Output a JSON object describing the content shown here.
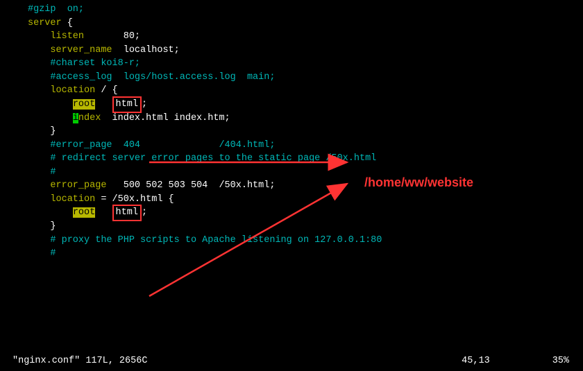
{
  "lines": {
    "l0": "#gzip  on;",
    "l1": "",
    "l2_a": "server {",
    "l3_a": "listen",
    "l3_b": "       80;",
    "l4_a": "server_name",
    "l4_b": "  localhost;",
    "l5": "",
    "l6": "#charset koi8-r;",
    "l7": "",
    "l8": "#access_log  logs/host.access.log  main;",
    "l9": "",
    "l10_a": "location",
    "l10_b": " / {",
    "l11_a": "root",
    "l11_b": "html",
    "l11_c": ";",
    "l12_a": "i",
    "l12_b": "ndex",
    "l12_c": "  index.html index.htm;",
    "l13": "}",
    "l14": "",
    "l15": "#error_page  404              /404.html;",
    "l16": "",
    "l17": "# redirect server error pages to the static page /50x.html",
    "l18": "#",
    "l19_a": "error_page",
    "l19_b": "   500 502 503 504  /50x.html;",
    "l20_a": "location",
    "l20_b": " = /50x.html {",
    "l21_a": "root",
    "l21_b": "html",
    "l21_c": ";",
    "l22": "}",
    "l23": "",
    "l24": "# proxy the PHP scripts to Apache listening on 127.0.0.1:80",
    "l25": "#"
  },
  "annotation": "/home/ww/website",
  "status": {
    "file": "\"nginx.conf\" 117L, 2656C",
    "position": "45,13",
    "percent": "35%"
  }
}
